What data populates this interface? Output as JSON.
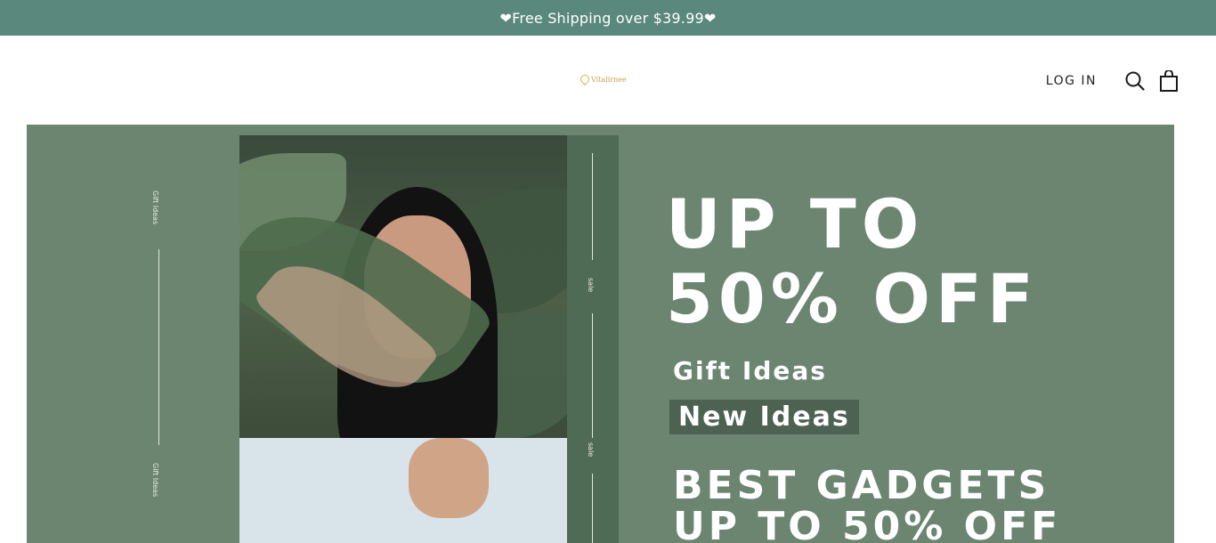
{
  "announcement": {
    "text": "❤Free Shipping over $39.99❤"
  },
  "header": {
    "logo_text": "Vitalirnee",
    "login_label": "LOG IN",
    "icons": {
      "search": "search-icon",
      "cart": "shopping-bag-icon"
    }
  },
  "hero": {
    "side_top": "Gift Ideas",
    "side_bottom": "Gift Ideas",
    "strip_top": "sale",
    "strip_bottom": "sale",
    "headline_line1": "UP TO",
    "headline_line2": "50% OFF",
    "gift_ideas": "Gift Ideas",
    "new_ideas": "New Ideas",
    "best_line1": "BEST GADGETS",
    "best_line2": "UP TO 50% OFF"
  },
  "colors": {
    "announcement_bg": "#5a887c",
    "hero_bg": "#6b8570",
    "strip_bg": "#4f6a55",
    "logo_gold": "#c9a24a"
  }
}
